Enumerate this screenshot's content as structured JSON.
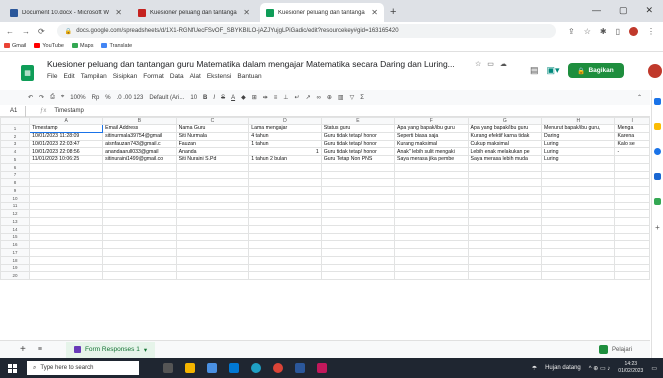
{
  "browser": {
    "tabs": [
      {
        "label": "Document 10.docx - Microsoft W",
        "color": "#2b579a"
      },
      {
        "label": "Kuesioner peluang dan tantanga",
        "color": "#c5221f"
      },
      {
        "label": "Kuesioner peluang dan tantanga",
        "color": "#0f9d58",
        "active": true
      }
    ],
    "url": "docs.google.com/spreadsheets/d/1X1-RGNfUecFSvOF_SBYKBILO-jAZJYujgLPiGadic/edit?resourcekey#gid=163165420",
    "bookmarks": [
      {
        "label": "Gmail",
        "color": "#ea4335"
      },
      {
        "label": "YouTube",
        "color": "#ff0000"
      },
      {
        "label": "Maps",
        "color": "#34a853"
      },
      {
        "label": "Translate",
        "color": "#4285f4"
      }
    ]
  },
  "doc": {
    "title": "Kuesioner peluang dan tantangan guru Matematika dalam mengajar Matematika secara Daring dan Luring...",
    "menus": [
      "File",
      "Edit",
      "Tampilan",
      "Sisipkan",
      "Format",
      "Data",
      "Alat",
      "Ekstensi",
      "Bantuan"
    ],
    "share_label": "Bagikan"
  },
  "toolbar": {
    "zoom": "100%",
    "currency": "Rp",
    "percent": "%",
    "decimals": ".0  .00  123",
    "font": "Default (Ari...",
    "size": "10"
  },
  "formula": {
    "cell": "A1",
    "value": "Timestamp"
  },
  "grid": {
    "columns": [
      "A",
      "B",
      "C",
      "D",
      "E",
      "F",
      "G",
      "H",
      "I"
    ],
    "headers": [
      "Timestamp",
      "Email Address",
      "Nama Guru",
      "Lama mengajar",
      "Status guru",
      "Apa yang bapak/ibu guru",
      "Apa yang bapak/ibu guru",
      "Menurut bapak/ibu guru,",
      "Menga"
    ],
    "rows": [
      [
        "10/01/2023 11:28:09",
        "sitinurmala39754@gmail",
        "Siti Nurmala",
        "4 tahun",
        "Guru tidak tetap/ honor",
        "Seperti biasa saja",
        "Kurang efektif karna tidak",
        "Daring",
        "Karena"
      ],
      [
        "10/01/2023 22:03:47",
        "aisnfauzan743@gmail.c",
        "Fauzan",
        "1 tahun",
        "Guru tidak tetap/ honor",
        "Kurang maksimal",
        "Cukup maksimal",
        "Luring",
        "Kalo se"
      ],
      [
        "10/01/2023 22:08:56",
        "anandaarull033@gmail",
        "Ananda",
        "1",
        "Guru tidak tetap/ honor",
        "Anak\" lebih sulit mengaki",
        "Lebih enak melakukan pe",
        "Luring",
        "-"
      ],
      [
        "11/01/2023 10:06:25",
        "sitinuraini1499@gmail.co",
        "Siti Nuraini S.Pd",
        "1 tahun 2 bulan",
        "Guru Tetap Non PNS",
        "Saya merasa jika pembe",
        "Saya merasa lebih muda",
        "Luring",
        ""
      ]
    ],
    "row_numbers": [
      "1",
      "2",
      "3",
      "4",
      "5",
      "6",
      "7",
      "8",
      "9",
      "10",
      "11",
      "12",
      "13",
      "14",
      "15",
      "16",
      "17",
      "18",
      "19",
      "20"
    ]
  },
  "sheet": {
    "tab_label": "Form Responses 1",
    "explore": "Pelajari"
  },
  "taskbar": {
    "search_placeholder": "Type here to search",
    "weather": "Hujan datang",
    "time": "14:23",
    "date": "01/02/2023"
  }
}
